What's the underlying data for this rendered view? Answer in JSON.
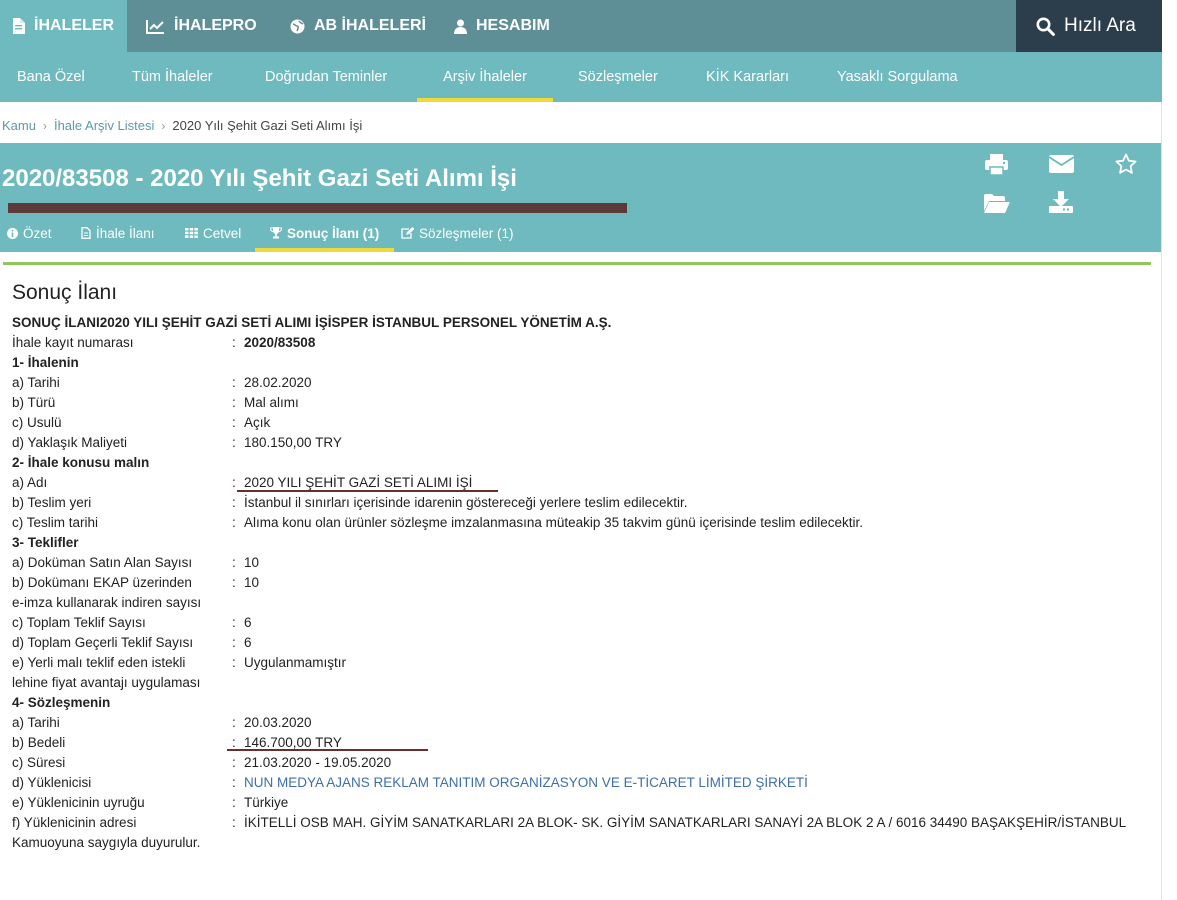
{
  "topnav": {
    "items": [
      "İHALELER",
      "İHALEPRO",
      "AB İHALELERİ",
      "HESABIM"
    ],
    "search_label": "Hızlı Ara"
  },
  "subnav": {
    "items": [
      "Bana Özel",
      "Tüm İhaleler",
      "Doğrudan Teminler",
      "Arşiv İhaleler",
      "Sözleşmeler",
      "KİK Kararları",
      "Yasaklı Sorgulama"
    ],
    "active": "Arşiv İhaleler"
  },
  "breadcrumb": [
    "Kamu",
    "İhale Arşiv Listesi",
    "2020 Yılı Şehit Gazi Seti Alımı İşi"
  ],
  "title": "2020/83508 - 2020 Yılı Şehit Gazi Seti Alımı İşi",
  "tabs": [
    "Özet",
    "İhale İlanı",
    "Cetvel",
    "Sonuç İlanı (1)",
    "Sözleşmeler (1)"
  ],
  "active_tab": "Sonuç İlanı (1)",
  "colors": {
    "teal": "#6fbabe",
    "dark_teal": "#5e8f96",
    "navy": "#2c3e4c",
    "accent_yellow": "#f0d93a",
    "green_rule": "#8fc75c",
    "link_blue": "#3d6fa9"
  },
  "content": {
    "heading": "Sonuç İlanı",
    "headline": "SONUÇ İLANI2020 YILI ŞEHİT GAZİ SETİ ALIMI İŞİSPER İSTANBUL PERSONEL YÖNETİM A.Ş.",
    "rows": [
      {
        "label": "İhale kayıt numarası",
        "value": "2020/83508",
        "bold_value": true
      },
      {
        "label": "1- İhalenin",
        "heading": true
      },
      {
        "label": "a) Tarihi",
        "value": "28.02.2020"
      },
      {
        "label": "b) Türü",
        "value": "Mal alımı"
      },
      {
        "label": "c) Usulü",
        "value": "Açık"
      },
      {
        "label": "d) Yaklaşık Maliyeti",
        "value": "180.150,00 TRY"
      },
      {
        "label": "2- İhale konusu malın",
        "heading": true
      },
      {
        "label": "a) Adı",
        "value": "2020 YILI ŞEHİT GAZİ SETİ ALIMI İŞİ"
      },
      {
        "label": "b) Teslim yeri",
        "value": "İstanbul il sınırları içerisinde idarenin göstereceği yerlere teslim edilecektir."
      },
      {
        "label": "c) Teslim tarihi",
        "value": "Alıma konu olan ürünler sözleşme imzalanmasına müteakip 35 takvim günü içerisinde teslim edilecektir."
      },
      {
        "label": "3- Teklifler",
        "heading": true
      },
      {
        "label": "a) Doküman Satın Alan Sayısı",
        "value": "10"
      },
      {
        "label": "b) Dokümanı EKAP üzerinden",
        "value": "10"
      },
      {
        "label": "e-imza kullanarak indiren sayısı",
        "continuation": true
      },
      {
        "label": "c) Toplam Teklif Sayısı",
        "value": "6"
      },
      {
        "label": "d) Toplam Geçerli Teklif Sayısı",
        "value": "6"
      },
      {
        "label": "e) Yerli malı teklif eden istekli",
        "value": "Uygulanmamıştır"
      },
      {
        "label": "lehine fiyat avantajı uygulaması",
        "continuation": true
      },
      {
        "label": "4- Sözleşmenin",
        "heading": true
      },
      {
        "label": "a) Tarihi",
        "value": "20.03.2020"
      },
      {
        "label": "b) Bedeli",
        "value": "146.700,00 TRY"
      },
      {
        "label": "c) Süresi",
        "value": "21.03.2020 - 19.05.2020"
      },
      {
        "label": "d) Yüklenicisi",
        "value": "NUN MEDYA AJANS REKLAM TANITIM ORGANİZASYON VE E-TİCARET LİMİTED ŞİRKETİ",
        "link": true
      },
      {
        "label": "e) Yüklenicinin uyruğu",
        "value": "Türkiye"
      },
      {
        "label": "f) Yüklenicinin adresi",
        "value": "İKİTELLİ OSB MAH. GİYİM SANATKARLARI 2A BLOK- SK. GİYİM SANATKARLARI SANAYİ 2A BLOK 2 A / 6016 34490 BAŞAKŞEHİR/İSTANBUL"
      }
    ],
    "colon": ":",
    "closing": "Kamuoyuna saygıyla duyurulur."
  }
}
